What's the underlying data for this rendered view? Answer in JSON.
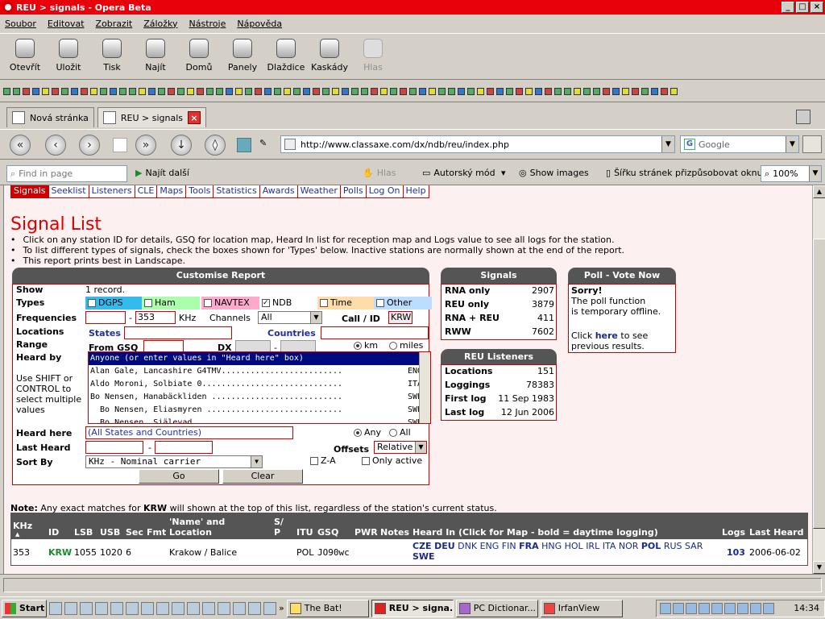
{
  "window": {
    "title": "REU > signals - Opera Beta"
  },
  "menu": [
    "Soubor",
    "Editovat",
    "Zobrazit",
    "Záložky",
    "Nástroje",
    "Nápověda"
  ],
  "toolbar": [
    {
      "label": "Otevřít",
      "icon": "open-icon"
    },
    {
      "label": "Uložit",
      "icon": "save-icon"
    },
    {
      "label": "Tisk",
      "icon": "print-icon"
    },
    {
      "label": "Najít",
      "icon": "find-icon"
    },
    {
      "label": "Domů",
      "icon": "home-icon"
    },
    {
      "label": "Panely",
      "icon": "panels-icon"
    },
    {
      "label": "Dlaždice",
      "icon": "tile-icon"
    },
    {
      "label": "Kaskády",
      "icon": "cascade-icon"
    },
    {
      "label": "Hlas",
      "icon": "voice-icon"
    }
  ],
  "tabs": [
    {
      "label": "Nová stránka"
    },
    {
      "label": "REU > signals"
    }
  ],
  "address": {
    "url": "http://www.classaxe.com/dx/ndb/reu/index.php"
  },
  "search": {
    "engine": "Google"
  },
  "findbar": {
    "placeholder": "Find in page",
    "find_next": "Najít další",
    "voice": "Hlas",
    "author_mode": "Autorský mód",
    "show_images": "Show images",
    "fit_width": "Šířku stránek přizpůsobovat oknu",
    "zoom": "100%"
  },
  "sitenav": [
    "Signals",
    "Seeklist",
    "Listeners",
    "CLE",
    "Maps",
    "Tools",
    "Statistics",
    "Awards",
    "Weather",
    "Polls",
    "Log On",
    "Help"
  ],
  "page": {
    "title": "Signal List",
    "bullets": [
      "Click on any station ID for details, GSQ for location map, Heard In list for reception map and Logs value to see all logs for the station.",
      "To list different types of signals, check the boxes shown for 'Types' below. Inactive stations are normally shown at the end of the report.",
      "This report prints best in Landscape."
    ]
  },
  "customise": {
    "header": "Customise Report",
    "show_label": "Show",
    "show_value": "1 record.",
    "types_label": "Types",
    "types": [
      {
        "label": "DGPS",
        "checked": false,
        "color": "#33bbee"
      },
      {
        "label": "Ham",
        "checked": false,
        "color": "#aaffaa"
      },
      {
        "label": "NAVTEX",
        "checked": false,
        "color": "#ffaacc"
      },
      {
        "label": "NDB",
        "checked": true,
        "color": "#ffffff"
      },
      {
        "label": "Time",
        "checked": false,
        "color": "#ffddaa"
      },
      {
        "label": "Other",
        "checked": false,
        "color": "#bbddff"
      }
    ],
    "freq_label": "Frequencies",
    "freq_from": "",
    "freq_to": "353",
    "khz": "KHz",
    "dash": "-",
    "channels_label": "Channels",
    "channels_value": "All",
    "callid_label": "Call / ID",
    "callid_value": "KRW",
    "locations_label": "Locations",
    "states_label": "States",
    "countries_label": "Countries",
    "range_label": "Range",
    "from_gsq": "From GSQ",
    "dx_label": "DX",
    "km": "km",
    "miles": "miles",
    "heardby_label": "Heard by",
    "heardby_hint": [
      "Use SHIFT or",
      "CONTROL to",
      "select multiple",
      "values"
    ],
    "heardby_options": [
      {
        "name": "Anyone (or enter values in \"Heard here\" box)",
        "code": ""
      },
      {
        "name": "Alan Gale, Lancashire G4TMV.........................",
        "code": "ENG"
      },
      {
        "name": "Aldo Moroni, Solbiate 0.............................",
        "code": "ITA"
      },
      {
        "name": "Bo Nensen, Hanabäckliden ...........................",
        "code": "SWE"
      },
      {
        "name": "  Bo Nensen, Eliasmyren ............................",
        "code": "SWE"
      },
      {
        "name": "  Bo Nensen, Själevad ..............................",
        "code": "SWE"
      }
    ],
    "heardhere_label": "Heard here",
    "heardhere_value": "(All States and Countries)",
    "any": "Any",
    "all": "All",
    "lastheard_label": "Last Heard",
    "offsets_label": "Offsets",
    "offsets_value": "Relative",
    "sortby_label": "Sort By",
    "sortby_value": "KHz - Nominal carrier",
    "za": "Z-A",
    "only_active": "Only active",
    "go": "Go",
    "clear": "Clear"
  },
  "signals_box": {
    "header": "Signals",
    "rows": [
      {
        "k": "RNA only",
        "v": "2907"
      },
      {
        "k": "REU only",
        "v": "3879"
      },
      {
        "k": "RNA + REU",
        "v": "411"
      },
      {
        "k": "RWW",
        "v": "7602"
      }
    ]
  },
  "listeners_box": {
    "header": "REU Listeners",
    "rows": [
      {
        "k": "Locations",
        "v": "151"
      },
      {
        "k": "Loggings",
        "v": "78383"
      },
      {
        "k": "First log",
        "v": "11 Sep 1983"
      },
      {
        "k": "Last log",
        "v": "12 Jun 2006"
      }
    ]
  },
  "poll_box": {
    "header": "Poll - Vote Now",
    "sorry": "Sorry!",
    "line1": "The poll function",
    "line2": "is temporary offline.",
    "click": "Click ",
    "here": "here",
    "rest": " to see",
    "line4": "previous results."
  },
  "note": {
    "bold": "Note:",
    "text1": " Any exact matches for ",
    "krw": "KRW",
    "text2": " will shown at the top of this list, regardless of the station's current status."
  },
  "results": {
    "headers": {
      "khz": "KHz",
      "id": "ID",
      "lsb": "LSB",
      "usb": "USB",
      "sec": "Sec",
      "fmt": "Fmt",
      "name1": "'Name' and",
      "name2": "Location",
      "sp1": "S/",
      "sp2": "P",
      "itu": "ITU",
      "gsq": "GSQ",
      "pwr": "PWR",
      "notes": "Notes",
      "heardin": "Heard In (Click for Map - bold = daytime logging)",
      "logs": "Logs",
      "last": "Last Heard"
    },
    "row": {
      "khz": "353",
      "id": "KRW",
      "lsb": "1055",
      "usb": "1020",
      "sec": "6",
      "fmt": "",
      "name": "Krakow / Balice",
      "sp": "",
      "itu": "POL",
      "gsq": "JO90wc",
      "pwr": "",
      "notes": "",
      "heardin": [
        {
          "c": "CZE",
          "b": true
        },
        {
          "c": "DEU",
          "b": true
        },
        {
          "c": "DNK",
          "b": false
        },
        {
          "c": "ENG",
          "b": false
        },
        {
          "c": "FIN",
          "b": false
        },
        {
          "c": "FRA",
          "b": true
        },
        {
          "c": "HNG",
          "b": false
        },
        {
          "c": "HOL",
          "b": false
        },
        {
          "c": "IRL",
          "b": false
        },
        {
          "c": "ITA",
          "b": false
        },
        {
          "c": "NOR",
          "b": false
        },
        {
          "c": "POL",
          "b": true
        },
        {
          "c": "RUS",
          "b": false
        },
        {
          "c": "SAR",
          "b": false
        },
        {
          "c": "SWE",
          "b": true
        }
      ],
      "logs": "103",
      "last": "2006-06-02"
    }
  },
  "taskbar": {
    "start": "Start",
    "tasks": [
      {
        "label": "The Bat!",
        "active": false
      },
      {
        "label": "REU > signa...",
        "active": true
      },
      {
        "label": "PC Dictionar...",
        "active": false
      },
      {
        "label": "IrfanView",
        "active": false
      }
    ],
    "clock": "14:34"
  }
}
